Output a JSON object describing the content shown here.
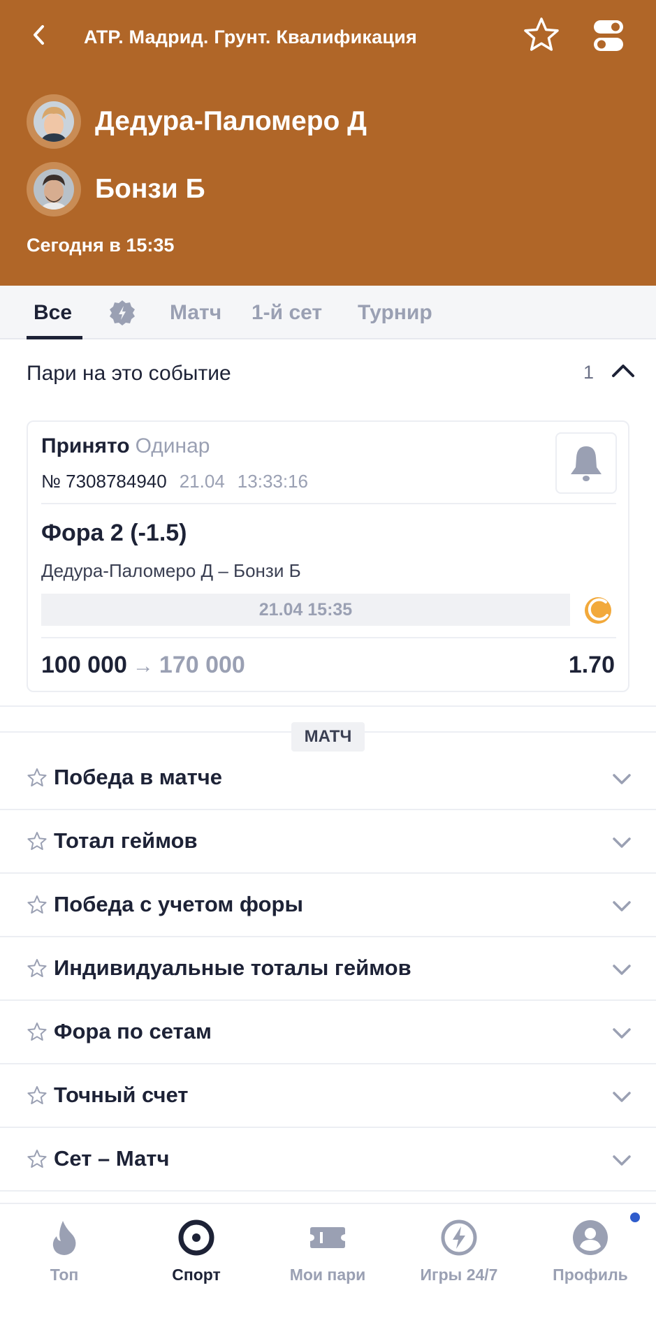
{
  "header": {
    "title": "ATP. Мадрид. Грунт. Квалификация",
    "player1": "Дедура-Паломеро Д",
    "player2": "Бонзи Б",
    "time": "Сегодня в 15:35",
    "bg_color": "#b06628",
    "icons": [
      "back-icon",
      "star-icon",
      "toggle-icon"
    ]
  },
  "tabs": {
    "items": [
      {
        "label": "Все",
        "active": true
      },
      {
        "label": "",
        "icon": "badge-icon"
      },
      {
        "label": "Матч"
      },
      {
        "label": "1-й сет"
      },
      {
        "label": "Турнир"
      }
    ]
  },
  "bets": {
    "title": "Пари на это событие",
    "count": "1",
    "card": {
      "status": "Принято",
      "type": "Одинар",
      "number": "№ 7308784940",
      "date": "21.04",
      "time": "13:33:16",
      "market": "Фора 2 (-1.5)",
      "event": "Дедура-Паломеро Д – Бонзи Б",
      "start": "21.04 15:35",
      "stake": "100 000",
      "arrow": "→",
      "payout": "170 000",
      "odds": "1.70"
    }
  },
  "markets": {
    "section_label": "МАТЧ",
    "items": [
      "Победа в матче",
      "Тотал геймов",
      "Победа с учетом форы",
      "Индивидуальные тоталы геймов",
      "Фора по сетам",
      "Точный счет",
      "Сет – Матч"
    ]
  },
  "nav": {
    "items": [
      {
        "label": "Топ",
        "icon": "flame-icon"
      },
      {
        "label": "Спорт",
        "icon": "sport-icon",
        "active": true
      },
      {
        "label": "Мои пари",
        "icon": "ticket-icon"
      },
      {
        "label": "Игры 24/7",
        "icon": "lightning-icon"
      },
      {
        "label": "Профиль",
        "icon": "profile-icon"
      }
    ],
    "notify_color": "#2f5ccc"
  }
}
